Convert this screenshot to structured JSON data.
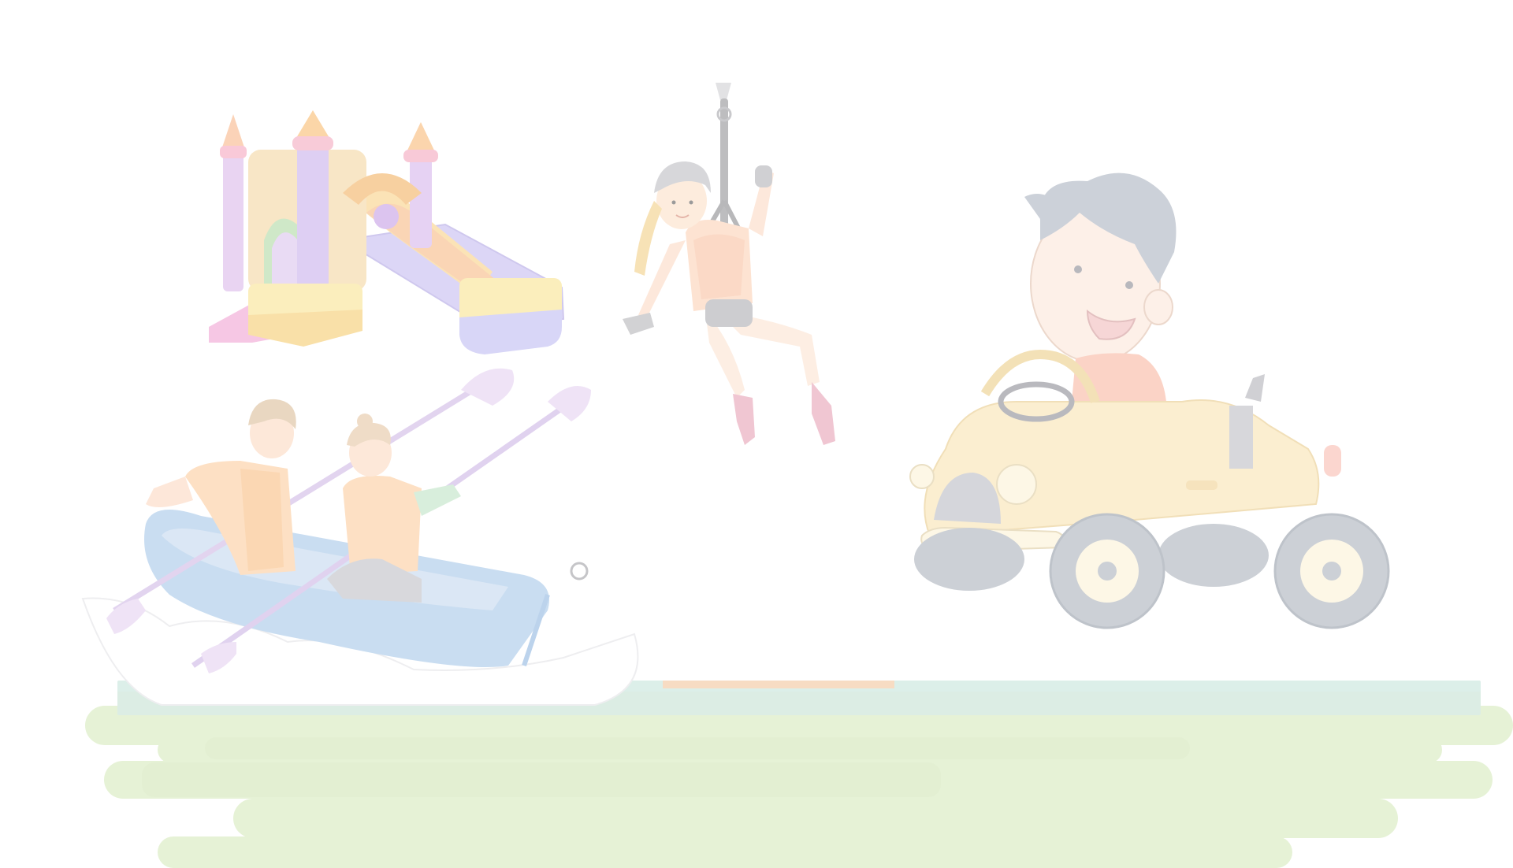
{
  "scene": {
    "sprites": [
      {
        "id": "bounce-castle",
        "icon": "bounce-castle-icon"
      },
      {
        "id": "zipline-girl",
        "icon": "zipline-icon"
      },
      {
        "id": "kayak-couple",
        "icon": "kayak-icon"
      },
      {
        "id": "boy-in-car",
        "icon": "toy-car-icon"
      }
    ]
  },
  "progress": {
    "start_fraction": 0.4,
    "end_fraction": 0.57
  },
  "colors": {
    "background": "#ffffff",
    "grass": "#e6f2d6",
    "grass_dark": "#e3efd2",
    "track_top": "#dcefe9",
    "track_bottom": "#dcede4",
    "progress_fill": "#f7dcc3",
    "castle_pink": "#f4c7e3",
    "castle_purple": "#d9cdf2",
    "castle_yellow": "#fbeab8",
    "kayak_blue": "#c8dcf0",
    "car_yellow": "#fbeed0",
    "hair_gray": "#ccd1d9",
    "shirt_orange": "#fbd3c6"
  }
}
